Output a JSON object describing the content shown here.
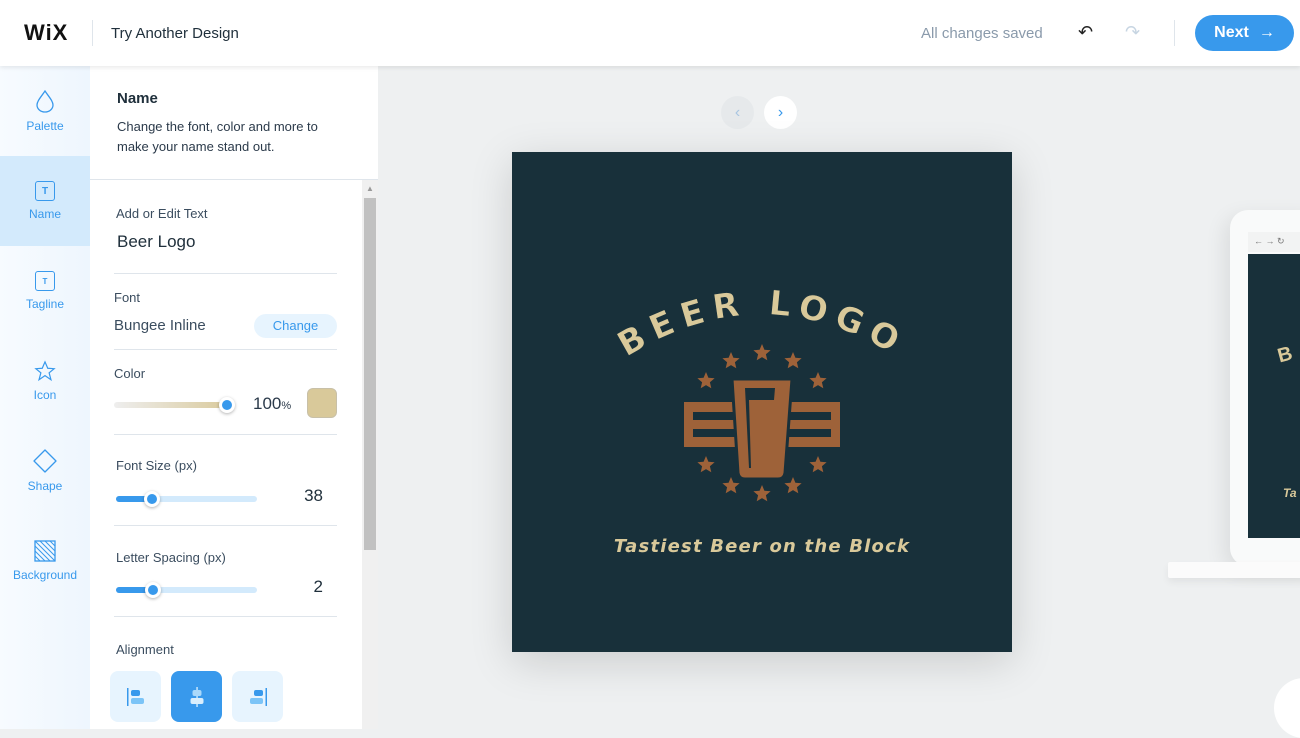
{
  "header": {
    "logo": "WiX",
    "title": "Try Another Design",
    "status": "All changes saved",
    "next_label": "Next"
  },
  "rail": {
    "items": [
      {
        "label": "Palette",
        "icon": "drop-icon"
      },
      {
        "label": "Name",
        "icon": "text-box-icon",
        "active": true
      },
      {
        "label": "Tagline",
        "icon": "text-box-small-icon"
      },
      {
        "label": "Icon",
        "icon": "star-icon"
      },
      {
        "label": "Shape",
        "icon": "diamond-icon"
      },
      {
        "label": "Background",
        "icon": "hatch-icon"
      }
    ]
  },
  "panel": {
    "title": "Name",
    "description": "Change the font, color and more to make your name stand out.",
    "text_label": "Add or Edit Text",
    "text_value": "Beer Logo",
    "font_label": "Font",
    "font_value": "Bungee Inline",
    "change_label": "Change",
    "color_label": "Color",
    "opacity": "100",
    "opacity_unit": "%",
    "color_value": "#d9c99a",
    "font_size_label": "Font Size (px)",
    "font_size": "38",
    "letter_spacing_label": "Letter Spacing (px)",
    "letter_spacing": "2",
    "alignment_label": "Alignment",
    "alignment_selected": "center"
  },
  "logo": {
    "name": "BEER LOGO",
    "tagline": "Tastiest Beer on the Block",
    "bg": "#18303a",
    "accent": "#9e6239",
    "text_color": "#d9c99a"
  },
  "preview": {
    "name_initial": "B",
    "tagline_partial": "Ta"
  },
  "colors": {
    "primary": "#3899ec"
  }
}
